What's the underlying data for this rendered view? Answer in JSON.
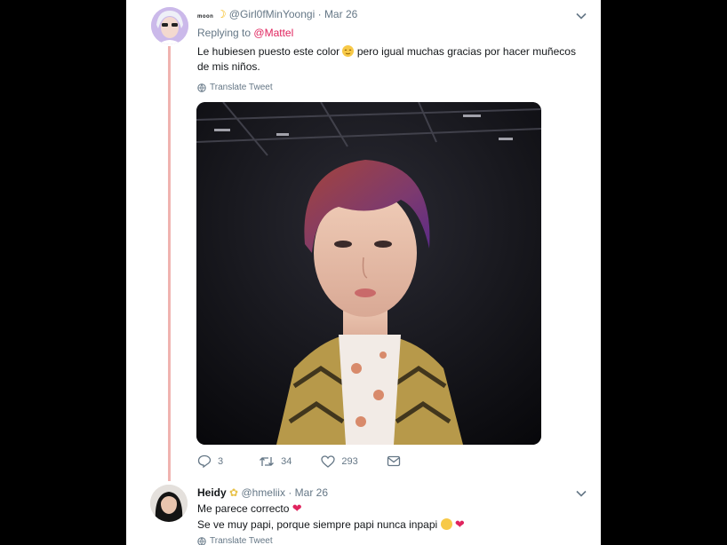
{
  "tweet1": {
    "display_name": "moon",
    "handle": "@Girl0fMinYoongi",
    "separator": "·",
    "date": "Mar 26",
    "replying_prefix": "Replying to",
    "replying_to": "@Mattel",
    "text_part1": "Le hubiesen puesto este color",
    "text_part2": "pero igual muchas gracias por hacer muñecos de mis niños.",
    "translate_label": "Translate Tweet",
    "replies": "3",
    "retweets": "34",
    "likes": "293"
  },
  "tweet2": {
    "display_name": "Heidy",
    "handle": "@hmeliix",
    "separator": "·",
    "date": "Mar 26",
    "line1": "Me parece correcto",
    "line2": "Se ve muy papi, porque siempre papi nunca inpapi",
    "translate_label": "Translate Tweet"
  },
  "colors": {
    "mention": "#e0245e",
    "thread_line": "#f0b3b0",
    "muted": "#657786",
    "heart": "#e0245e"
  }
}
